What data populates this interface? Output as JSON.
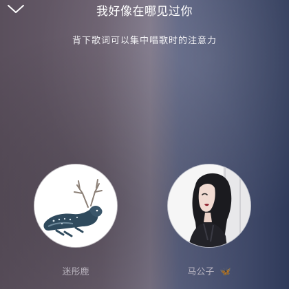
{
  "header": {
    "title": "我好像在哪见过你",
    "back_icon": "chevron-down-icon"
  },
  "subtitle": "背下歌词可以集中唱歌时的注意力",
  "participants": [
    {
      "name": "迷彤鹿",
      "avatar": "deer-avatar"
    },
    {
      "name": "马公子",
      "badge": "🦋",
      "avatar": "girl-portrait-avatar"
    }
  ],
  "colors": {
    "title_text": "#ffffff",
    "subtitle_text": "#f1f1f4",
    "name_text": "#c7c2cc",
    "badge": "#7ac4ff"
  }
}
